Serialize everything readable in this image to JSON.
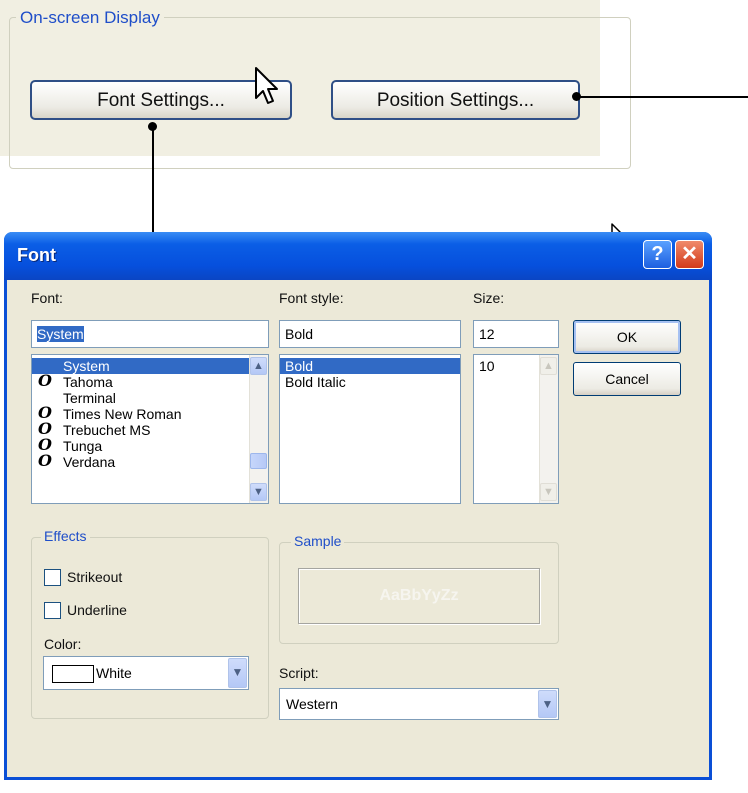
{
  "osd": {
    "legend": "On-screen Display",
    "font_settings_label": "Font Settings...",
    "position_settings_label": "Position Settings..."
  },
  "dialog": {
    "title": "Font",
    "help_glyph": "?",
    "close_glyph": "✕",
    "font": {
      "label": "Font:",
      "value": "System",
      "items": [
        {
          "name": "System",
          "truetype": false,
          "selected": true
        },
        {
          "name": "Tahoma",
          "truetype": true,
          "selected": false
        },
        {
          "name": "Terminal",
          "truetype": false,
          "selected": false
        },
        {
          "name": "Times New Roman",
          "truetype": true,
          "selected": false
        },
        {
          "name": "Trebuchet MS",
          "truetype": true,
          "selected": false
        },
        {
          "name": "Tunga",
          "truetype": true,
          "selected": false
        },
        {
          "name": "Verdana",
          "truetype": true,
          "selected": false
        }
      ],
      "truetype_glyph": "O"
    },
    "style": {
      "label": "Font style:",
      "value": "Bold",
      "items": [
        {
          "name": "Bold",
          "selected": true
        },
        {
          "name": "Bold Italic",
          "selected": false
        }
      ]
    },
    "size": {
      "label": "Size:",
      "value": "12",
      "items": [
        {
          "name": "10",
          "selected": false
        }
      ]
    },
    "ok_label": "OK",
    "cancel_label": "Cancel",
    "effects": {
      "legend": "Effects",
      "strikeout_label": "Strikeout",
      "underline_label": "Underline",
      "strikeout_checked": false,
      "underline_checked": false,
      "color_label": "Color:",
      "color_value": "White"
    },
    "sample": {
      "legend": "Sample",
      "text": "AaBbYyZz"
    },
    "script": {
      "label": "Script:",
      "value": "Western"
    }
  },
  "colors": {
    "titlebar_blue": "#0650dd",
    "selection_blue": "#316ac5",
    "group_label_blue": "#1f4ec9",
    "dialog_bg": "#ece9d8"
  },
  "icons": {
    "cursor": "arrow-pointer-icon",
    "dropdown": "chevron-down-icon",
    "scroll_up": "chevron-up-icon"
  }
}
